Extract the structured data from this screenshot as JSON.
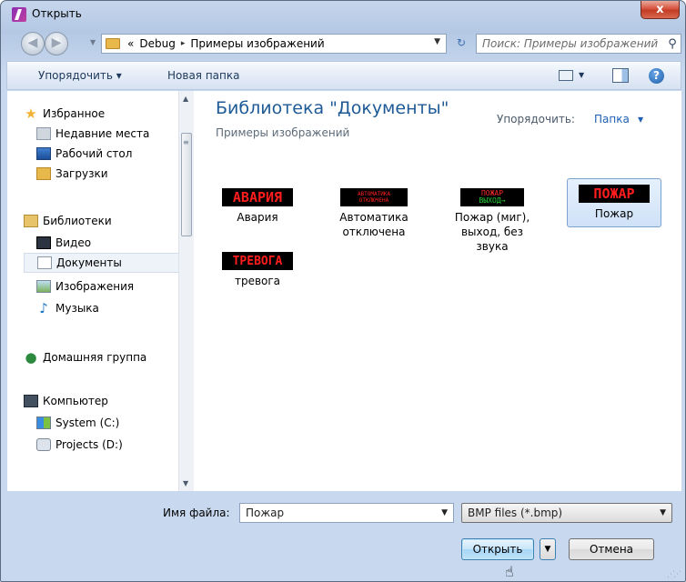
{
  "window": {
    "title": "Открыть",
    "close_label": "x"
  },
  "address": {
    "crumb_prefix": "«",
    "crumbs": [
      "Debug",
      "Примеры изображений"
    ],
    "separator": "▸"
  },
  "search": {
    "placeholder": "Поиск: Примеры изображений"
  },
  "toolbar": {
    "organize": "Упорядочить ▾",
    "new_folder": "Новая папка",
    "help": "?"
  },
  "sidebar": {
    "favorites": {
      "label": "Избранное",
      "items": [
        "Недавние места",
        "Рабочий стол",
        "Загрузки"
      ]
    },
    "libraries": {
      "label": "Библиотеки",
      "items": [
        "Видео",
        "Документы",
        "Изображения",
        "Музыка"
      ],
      "selected": "Документы"
    },
    "homegroup": "Домашняя группа",
    "computer": {
      "label": "Компьютер",
      "items": [
        "System (C:)",
        "Projects (D:)"
      ]
    }
  },
  "library": {
    "title": "Библиотека \"Документы\"",
    "subtitle": "Примеры изображений",
    "arrange_label": "Упорядочить:",
    "arrange_value": "Папка"
  },
  "files": [
    {
      "name": "Авария",
      "thumb": "АВАРИЯ"
    },
    {
      "name": "Автоматика отключена",
      "thumb_lines": [
        "АВТОМАТИКА",
        "ОТКЛЮЧЕНА"
      ]
    },
    {
      "name": "Пожар (миг), выход, без звука",
      "thumb_lines": [
        "ПОЖАР",
        "ВЫХОД→"
      ]
    },
    {
      "name": "Пожар",
      "thumb": "ПОЖАР",
      "selected": true
    },
    {
      "name": "тревога",
      "thumb": "ТРЕВОГА"
    }
  ],
  "bottom": {
    "filename_label": "Имя файла:",
    "filename_value": "Пожар",
    "filetype": "BMP files (*.bmp)",
    "open_label": "Открыть",
    "cancel_label": "Отмена"
  },
  "colors": {
    "led_red": "#ff1d1d",
    "led_green": "#24d13b",
    "link_blue": "#1f5fb4",
    "title_blue": "#1e5a96"
  }
}
